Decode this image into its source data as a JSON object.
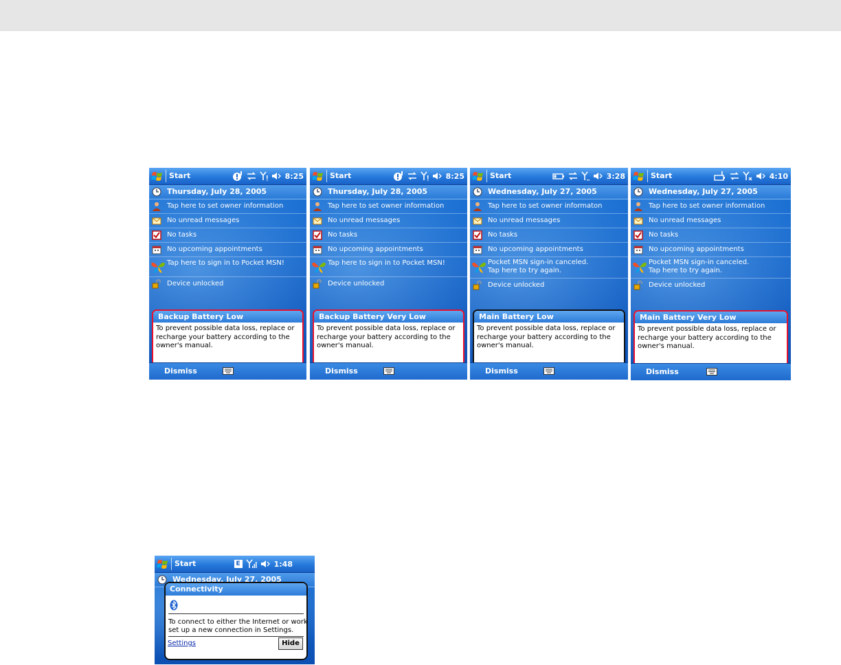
{
  "screens": [
    {
      "start": "Start",
      "time": "8:25",
      "tray": "alarm",
      "date": "Thursday, July 28, 2005",
      "owner": "Tap here to set owner information",
      "messages": "No unread messages",
      "tasks": "No tasks",
      "appointments": "No upcoming appointments",
      "msn_line1": "Tap here to sign in to Pocket MSN!",
      "msn_line2": "",
      "device": "Device unlocked",
      "bubble_title": "Backup Battery Low",
      "bubble_line1": "To prevent possible data loss, replace or",
      "bubble_line2": "recharge your battery according to the",
      "bubble_line3": "owner's manual.",
      "bubble_color": "#e8112d",
      "soft_left": "Dismiss"
    },
    {
      "start": "Start",
      "time": "8:25",
      "tray": "alarm",
      "date": "Thursday, July 28, 2005",
      "owner": "Tap here to set owner information",
      "messages": "No unread messages",
      "tasks": "No tasks",
      "appointments": "No upcoming appointments",
      "msn_line1": "Tap here to sign in to Pocket MSN!",
      "msn_line2": "",
      "device": "Device unlocked",
      "bubble_title": "Backup Battery Very Low",
      "bubble_line1": "To prevent possible data loss, replace or",
      "bubble_line2": "recharge your battery according to the",
      "bubble_line3": "owner's manual.",
      "bubble_color": "#e8112d",
      "soft_left": "Dismiss"
    },
    {
      "start": "Start",
      "time": "3:28",
      "tray": "battery",
      "date": "Wednesday, July 27, 2005",
      "owner": "Tap here to set owner informaton",
      "messages": "No unread messages",
      "tasks": "No tasks",
      "appointments": "No upcoming appointments",
      "msn_line1": "Pocket MSN sign-in canceled.",
      "msn_line2": "Tap here to try again.",
      "device": "Device unlocked",
      "bubble_title": "Main Battery Low",
      "bubble_line1": "To prevent possible data loss, replace or",
      "bubble_line2": "recharge your battery according to the",
      "bubble_line3": "owner's manual.",
      "bubble_color": "#111111",
      "soft_left": "Dismiss"
    },
    {
      "start": "Start",
      "time": "4:10",
      "tray": "battery",
      "date": "Wednesday, July 27, 2005",
      "owner": "Tap here to set owner information",
      "messages": "No unread messages",
      "tasks": "No tasks",
      "appointments": "No upcoming appointments",
      "msn_line1": "Pocket MSN sign-in canceled.",
      "msn_line2": "Tap here to try again.",
      "device": "Device unlocked",
      "bubble_title": "Main Battery Very Low",
      "bubble_line1": "To prevent possible data loss, replace or",
      "bubble_line2": "recharge your battery according to the",
      "bubble_line3": "owner's manual.",
      "bubble_color": "#e8112d",
      "soft_left": "Dismiss"
    }
  ],
  "connectivity": {
    "start": "Start",
    "edge_badge": "E",
    "time": "1:48",
    "date_partial": "Wednesday, July 27, 2005",
    "popup_title": "Connectivity",
    "text_line1": "To connect to either the Internet or work,",
    "text_line2": "set up a new connection in Settings.",
    "settings_link": "Settings",
    "hide_button": "Hide"
  },
  "icons": {
    "windows": "windows-flag-icon",
    "date": "clock-icon",
    "owner": "owner-person-icon",
    "messages": "envelope-icon",
    "tasks": "task-checkbox-icon",
    "appointments": "calendar-icon",
    "msn": "msn-butterfly-icon",
    "device": "padlock-icon",
    "keyboard": "keyboard-icon",
    "bluetooth": "bluetooth-icon"
  },
  "colors": {
    "alert_red": "#e8112d",
    "title_blue": "#2679db",
    "link_blue": "#0a2aa8"
  }
}
